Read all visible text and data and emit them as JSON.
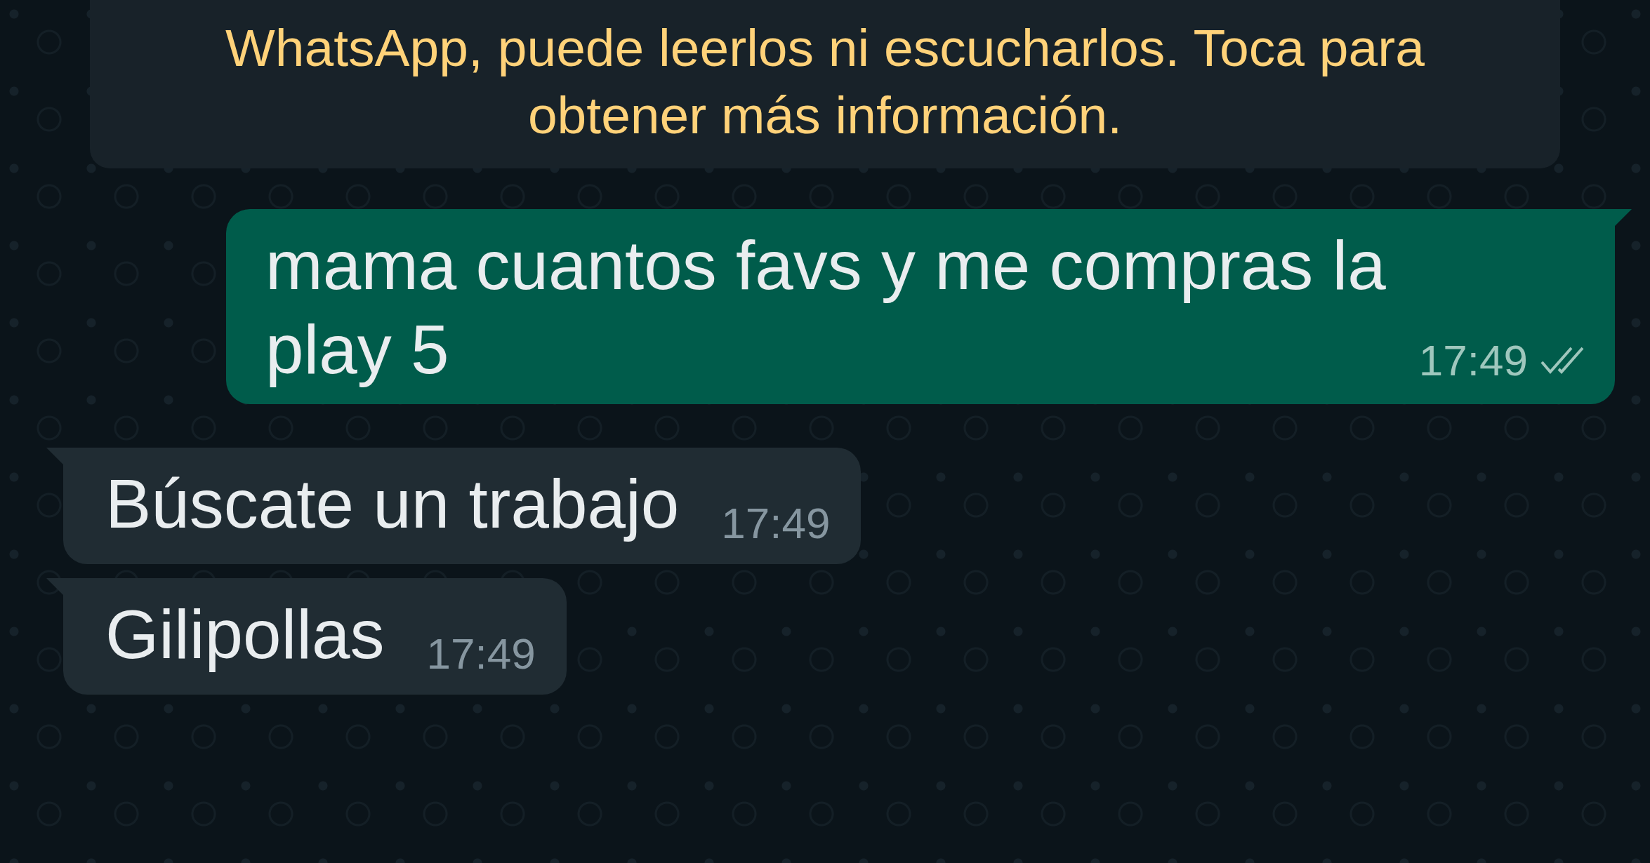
{
  "notice": {
    "text": "WhatsApp, puede leerlos ni escucharlos. Toca para obtener más información."
  },
  "messages": [
    {
      "kind": "outgoing",
      "text": "mama cuantos favs y me compras la play 5",
      "time": "17:49",
      "read": false
    },
    {
      "kind": "incoming",
      "text": "Búscate un trabajo",
      "time": "17:49"
    },
    {
      "kind": "incoming",
      "text": "Gilipollas",
      "time": "17:49"
    }
  ]
}
